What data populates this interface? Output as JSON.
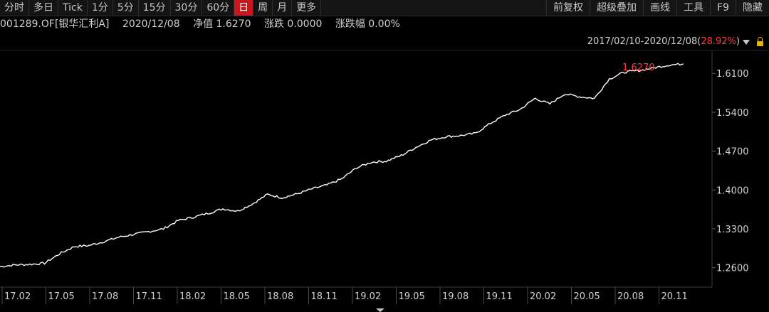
{
  "toolbar": {
    "left": [
      "分时",
      "多日",
      "Tick",
      "1分",
      "5分",
      "15分",
      "30分",
      "60分",
      "日",
      "周",
      "月",
      "更多"
    ],
    "active_index": 8,
    "right": [
      "前复权",
      "超级叠加",
      "画线",
      "工具",
      "F9",
      "隐藏"
    ]
  },
  "info": {
    "fund": "001289.OF[银华汇利A]",
    "date": "2020/12/08",
    "nav": "净值 1.6270",
    "change": "涨跌 0.0000",
    "change_pct": "涨跌幅 0.00%"
  },
  "range": {
    "period": "2017/02/10-2020/12/08(",
    "pct": "28.92%",
    "close": ")"
  },
  "colors": {
    "line": "#ffffff",
    "last_label": "#ff3b3b",
    "active_tab": "#c8161d",
    "axis_text": "#d0d0d0"
  },
  "chart_data": {
    "type": "line",
    "title": "",
    "xlabel": "",
    "ylabel": "",
    "last_value_label": "1.6270",
    "ylim": [
      1.225,
      1.65
    ],
    "yticks": [
      "1.6100",
      "1.5400",
      "1.4700",
      "1.4000",
      "1.3300",
      "1.2600"
    ],
    "ytick_values": [
      1.61,
      1.54,
      1.47,
      1.4,
      1.33,
      1.26
    ],
    "xticks": [
      "17.02",
      "17.05",
      "17.08",
      "17.11",
      "18.02",
      "18.05",
      "18.08",
      "18.11",
      "19.02",
      "19.05",
      "19.08",
      "19.11",
      "20.02",
      "20.05",
      "20.08",
      "20.11"
    ],
    "series": [
      {
        "x": [
          "2017-02",
          "2017-03",
          "2017-04",
          "2017-05",
          "2017-06",
          "2017-07",
          "2017-08",
          "2017-09",
          "2017-10",
          "2017-11",
          "2017-12",
          "2018-01",
          "2018-02",
          "2018-03",
          "2018-04",
          "2018-05",
          "2018-06",
          "2018-07",
          "2018-08",
          "2018-09",
          "2018-10",
          "2018-11",
          "2018-12",
          "2019-01",
          "2019-02",
          "2019-03",
          "2019-04",
          "2019-05",
          "2019-06",
          "2019-07",
          "2019-08",
          "2019-09",
          "2019-10",
          "2019-11",
          "2019-12",
          "2020-01",
          "2020-02",
          "2020-03",
          "2020-04",
          "2020-05",
          "2020-06",
          "2020-07",
          "2020-08",
          "2020-09",
          "2020-10",
          "2020-11",
          "2020-12"
        ],
        "values": [
          1.262,
          1.265,
          1.266,
          1.268,
          1.285,
          1.298,
          1.3,
          1.307,
          1.315,
          1.32,
          1.325,
          1.33,
          1.345,
          1.351,
          1.358,
          1.366,
          1.362,
          1.375,
          1.392,
          1.386,
          1.393,
          1.402,
          1.409,
          1.42,
          1.44,
          1.45,
          1.452,
          1.462,
          1.477,
          1.49,
          1.496,
          1.498,
          1.502,
          1.52,
          1.535,
          1.545,
          1.565,
          1.555,
          1.573,
          1.568,
          1.565,
          1.6,
          1.612,
          1.615,
          1.62,
          1.625,
          1.627
        ]
      }
    ]
  }
}
